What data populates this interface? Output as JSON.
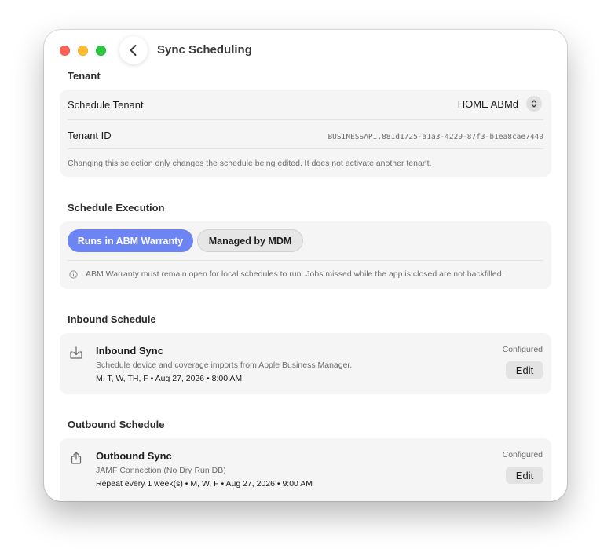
{
  "window": {
    "title": "Sync Scheduling"
  },
  "tenant": {
    "section_title": "Tenant",
    "schedule_tenant_label": "Schedule Tenant",
    "schedule_tenant_value": "HOME ABMd",
    "tenant_id_label": "Tenant ID",
    "tenant_id_value": "BUSINESSAPI.881d1725-a1a3-4229-87f3-b1ea8cae7440",
    "note": "Changing this selection only changes the schedule being edited. It does not activate another tenant."
  },
  "execution": {
    "section_title": "Schedule Execution",
    "options": [
      "Runs in ABM Warranty",
      "Managed by MDM"
    ],
    "selected": "Runs in ABM Warranty",
    "info": "ABM Warranty must remain open for local schedules to run. Jobs missed while the app is closed are not backfilled."
  },
  "inbound": {
    "section_title": "Inbound Schedule",
    "title": "Inbound Sync",
    "description": "Schedule device and coverage imports from Apple Business Manager.",
    "when": "M, T, W, TH, F • Aug 27, 2026 • 8:00 AM",
    "status": "Configured",
    "edit_label": "Edit"
  },
  "outbound": {
    "section_title": "Outbound Schedule",
    "title": "Outbound Sync",
    "description": "JAMF Connection (No Dry Run DB)",
    "when": "Repeat every 1 week(s) • M, W, F • Aug 27, 2026 • 9:00 AM",
    "status": "Configured",
    "edit_label": "Edit"
  },
  "colors": {
    "accent": "#6d84f4",
    "card_background": "#f5f5f5",
    "close": "#ff5f57",
    "minimize": "#febc2e",
    "zoom": "#28c840"
  },
  "icons": {
    "back": "chevron-left-icon",
    "stepper": "chevron-up-down-icon",
    "info": "info-circle-icon",
    "inbound": "tray-arrow-down-icon",
    "outbound": "share-arrow-up-icon"
  }
}
